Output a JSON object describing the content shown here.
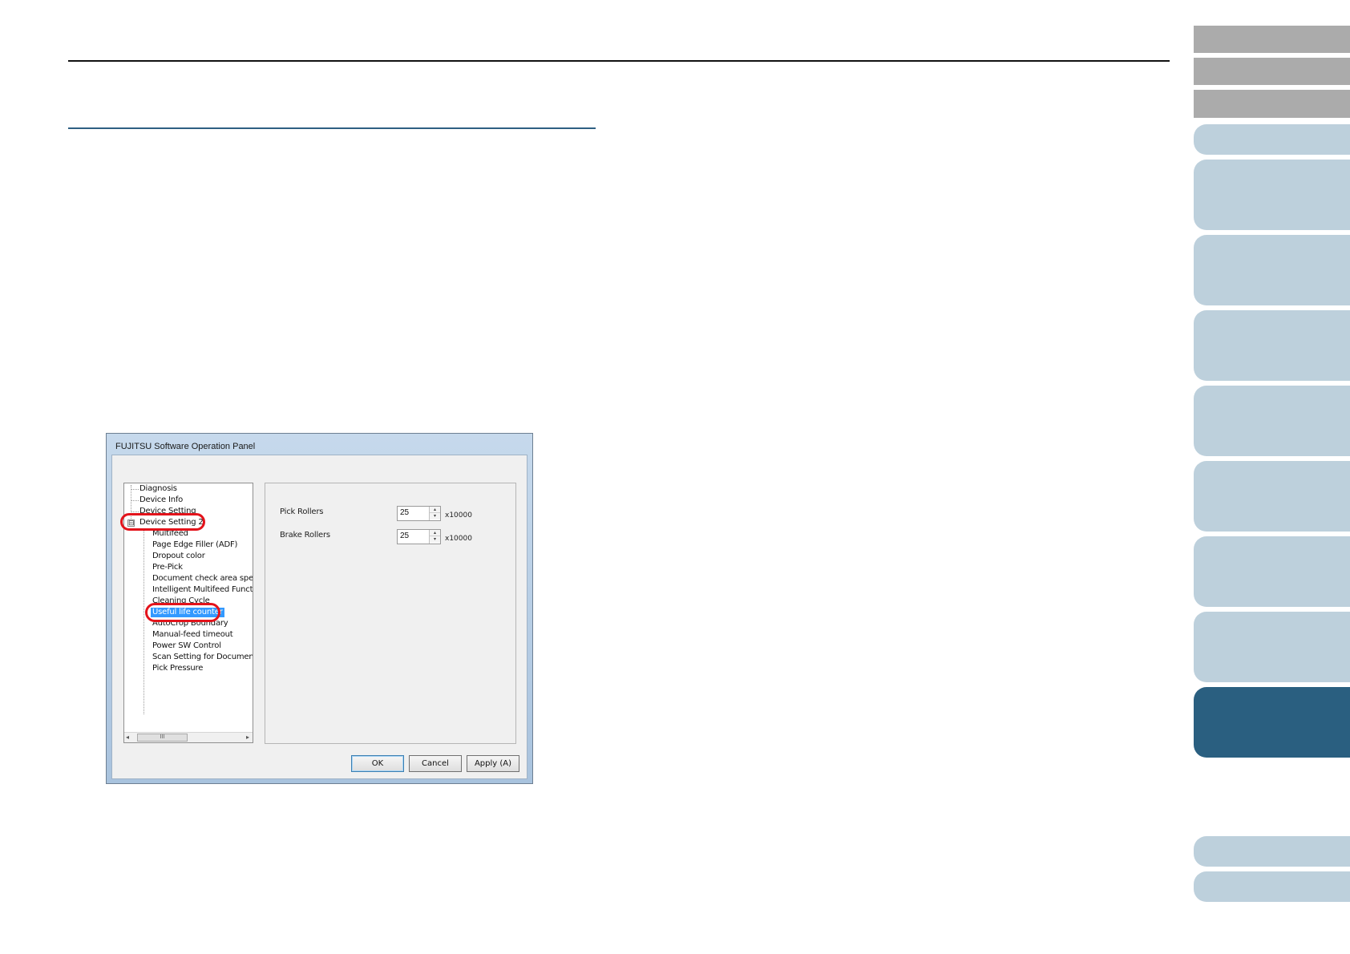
{
  "dialog": {
    "title": "FUJITSU Software Operation Panel",
    "tree": {
      "items": [
        "Diagnosis",
        "Device Info",
        "Device Setting",
        "Device Setting 2",
        "Multifeed",
        "Page Edge Filler (ADF)",
        "Dropout color",
        "Pre-Pick",
        "Document check area specific",
        "Intelligent Multifeed Function",
        "Cleaning Cycle",
        "Useful life counter",
        "AutoCrop Boundary",
        "Manual-feed timeout",
        "Power SW Control",
        "Scan Setting for Document wi",
        "Pick Pressure"
      ],
      "expander_symbol": "⊟",
      "selected_item": "Useful life counter",
      "scroll_thumb": "III",
      "scroll_left": "◂",
      "scroll_right": "▸"
    },
    "fields": [
      {
        "label": "Pick Rollers",
        "value": "25",
        "unit": "x10000"
      },
      {
        "label": "Brake Rollers",
        "value": "25",
        "unit": "x10000"
      }
    ],
    "buttons": {
      "ok": "OK",
      "cancel": "Cancel",
      "apply": "Apply (A)"
    },
    "spin_up": "▴",
    "spin_down": "▾"
  },
  "colors": {
    "highlight_ring": "#e3131b",
    "nav_active": "#2a5f80",
    "nav_light": "#bdd0dc",
    "nav_gray": "#ababab",
    "section_rule": "#2e5f82"
  }
}
